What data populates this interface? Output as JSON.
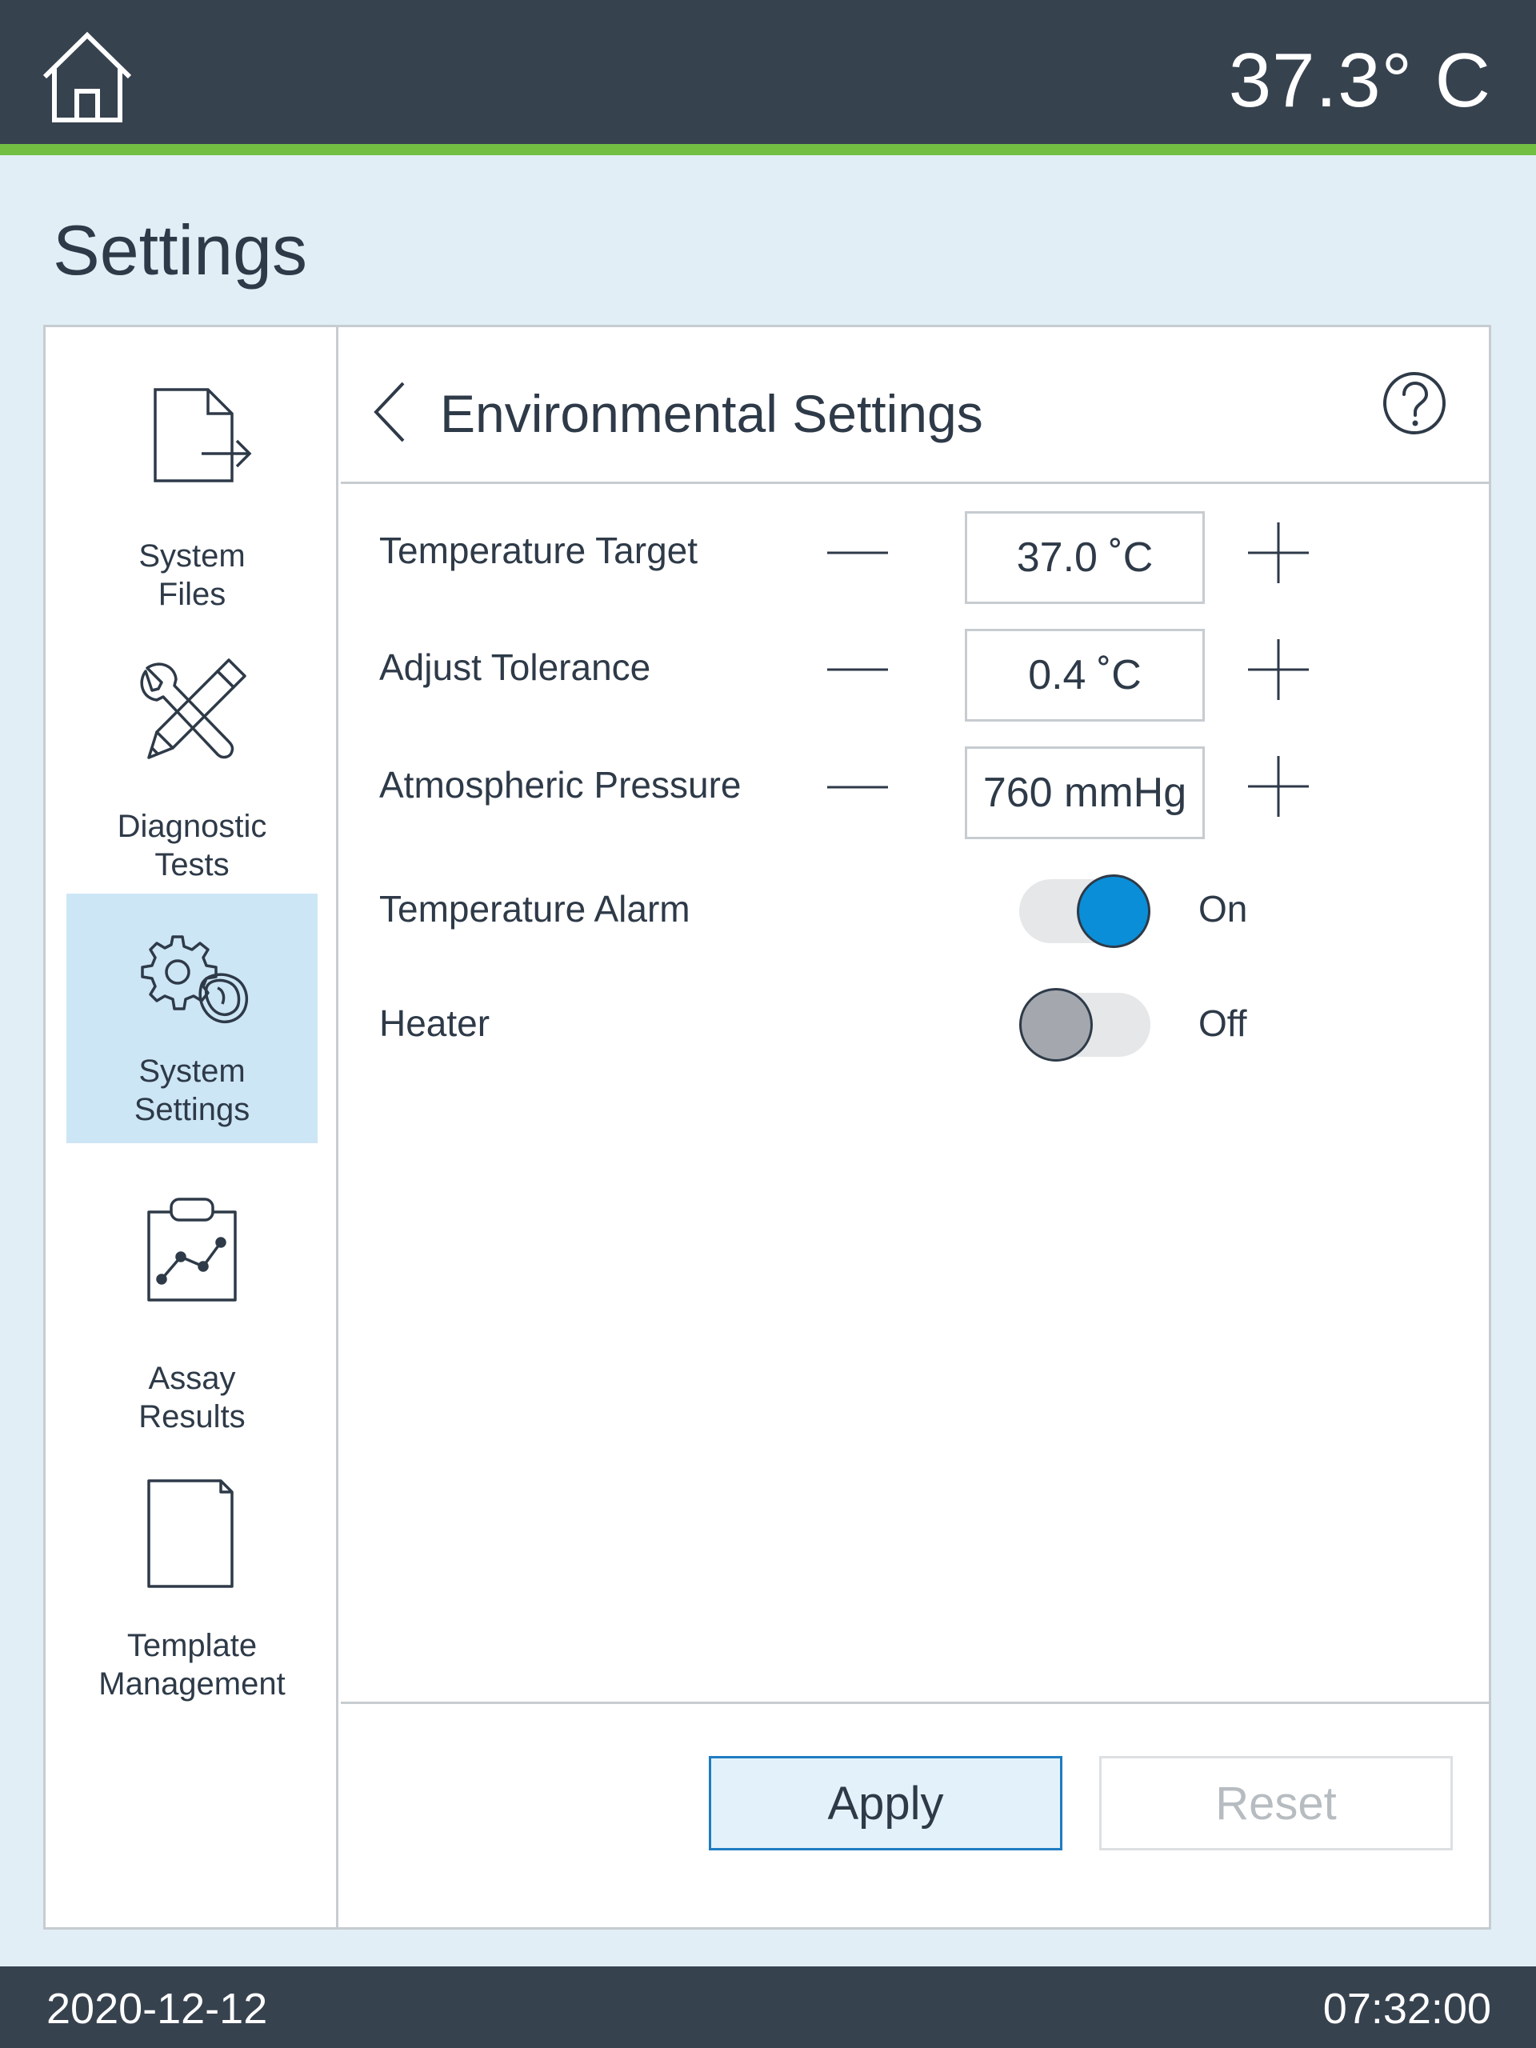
{
  "header": {
    "home_icon": "home-icon",
    "temperature": "37.3° C"
  },
  "page_title": "Settings",
  "sidebar": {
    "items": [
      {
        "line1": "System",
        "line2": "Files",
        "icon": "file-export-icon",
        "active": false
      },
      {
        "line1": "Diagnostic",
        "line2": "Tests",
        "icon": "tools-icon",
        "active": false
      },
      {
        "line1": "System",
        "line2": "Settings",
        "icon": "gear-instrument-icon",
        "active": true
      },
      {
        "line1": "Assay",
        "line2": "Results",
        "icon": "clipboard-chart-icon",
        "active": false
      },
      {
        "line1": "Template",
        "line2": "Management",
        "icon": "document-icon",
        "active": false
      }
    ]
  },
  "content": {
    "title": "Environmental Settings",
    "back_icon": "chevron-left-icon",
    "help_icon": "help-icon",
    "rows": [
      {
        "label": "Temperature Target",
        "value": "37.0 ˚C"
      },
      {
        "label": "Adjust Tolerance",
        "value": "0.4 ˚C"
      },
      {
        "label": "Atmospheric Pressure",
        "value": "760 mmHg"
      }
    ],
    "toggles": [
      {
        "label": "Temperature Alarm",
        "state": "On",
        "on": true
      },
      {
        "label": "Heater",
        "state": "Off",
        "on": false
      }
    ]
  },
  "buttons": {
    "apply": "Apply",
    "reset": "Reset"
  },
  "footer": {
    "date": "2020-12-12",
    "time": "07:32:00"
  },
  "colors": {
    "header_bg": "#37424f",
    "accent_green": "#72bf44",
    "page_bg": "#e1eef6",
    "active_nav": "#cde6f6",
    "toggle_on": "#0a8ed8",
    "toggle_off": "#a4a8ae",
    "apply_border": "#1f7cc1"
  }
}
